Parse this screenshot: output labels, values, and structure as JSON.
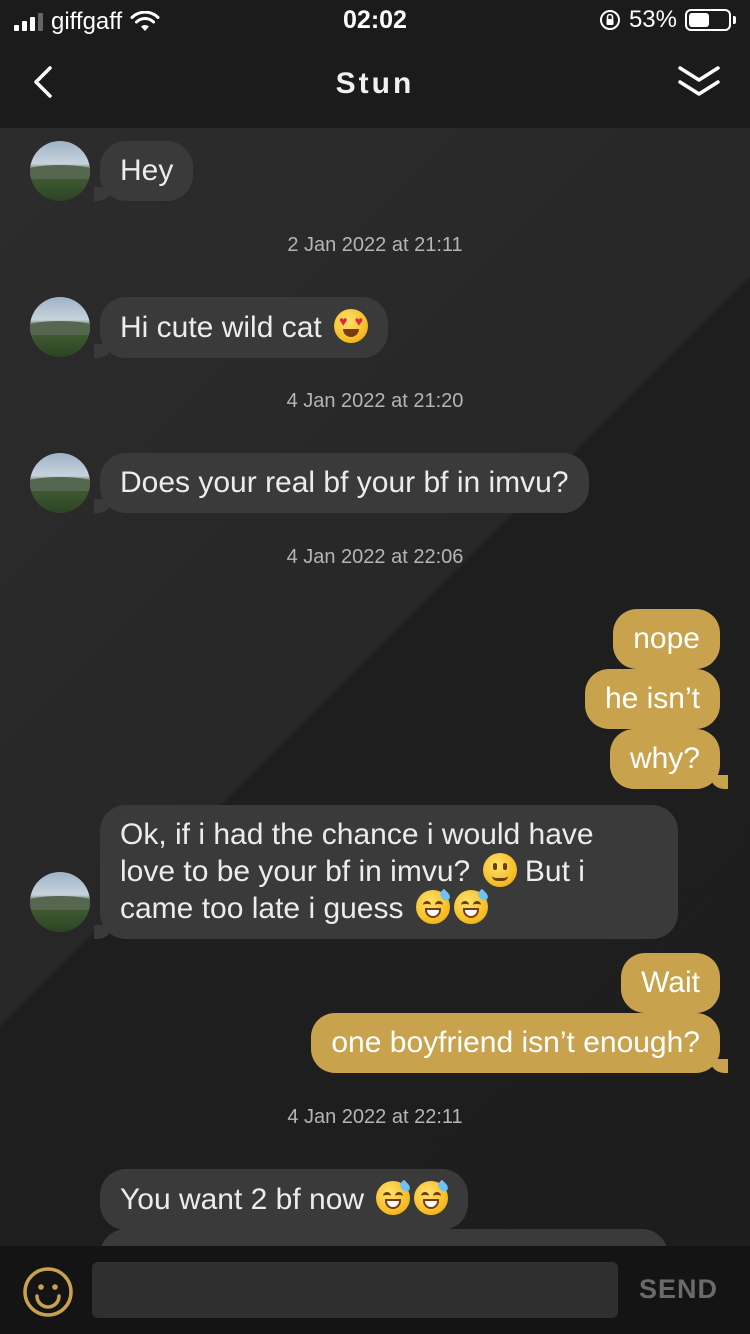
{
  "status_bar": {
    "carrier": "giffgaff",
    "time": "02:02",
    "battery_percent": "53%",
    "battery_level": 0.53,
    "icons": [
      "signal-icon",
      "wifi-icon",
      "rotation-lock-icon",
      "battery-icon"
    ]
  },
  "header": {
    "title": "Stun",
    "back_icon": "chevron-left-icon",
    "collapse_icon": "double-chevron-down-icon"
  },
  "messages": [
    {
      "type": "incoming",
      "text": "Hey"
    },
    {
      "type": "timestamp",
      "text": "2 Jan 2022 at 21:11"
    },
    {
      "type": "incoming",
      "text": "Hi cute wild cat",
      "emoji": [
        "heart-eyes"
      ]
    },
    {
      "type": "timestamp",
      "text": "4 Jan 2022 at 21:20"
    },
    {
      "type": "incoming",
      "text": "Does your real bf your bf in imvu?"
    },
    {
      "type": "timestamp",
      "text": "4 Jan 2022 at 22:06"
    },
    {
      "type": "outgoing",
      "text": "nope"
    },
    {
      "type": "outgoing",
      "text": "he isn’t"
    },
    {
      "type": "outgoing",
      "text": "why?"
    },
    {
      "type": "incoming",
      "lines": [
        "Ok, if i had the chance i would have",
        "love to be your bf in imvu?",
        "But i",
        "came too late i guess"
      ],
      "emoji": [
        "slightly-smiling",
        "sweat-smile",
        "sweat-smile"
      ]
    },
    {
      "type": "outgoing",
      "text": "Wait"
    },
    {
      "type": "outgoing",
      "text": "one boyfriend isn’t enough?"
    },
    {
      "type": "timestamp",
      "text": "4 Jan 2022 at 22:11"
    },
    {
      "type": "incoming",
      "text": "You want 2 bf now",
      "emoji": [
        "sweat-smile",
        "sweat-smile"
      ]
    }
  ],
  "composer": {
    "emoji_icon": "smiley-icon",
    "input_value": "",
    "input_placeholder": "",
    "send_label": "SEND"
  },
  "colors": {
    "accent": "#c9a24d",
    "incoming_bubble": "#3a3a3a",
    "background": "#1c1c1c"
  }
}
